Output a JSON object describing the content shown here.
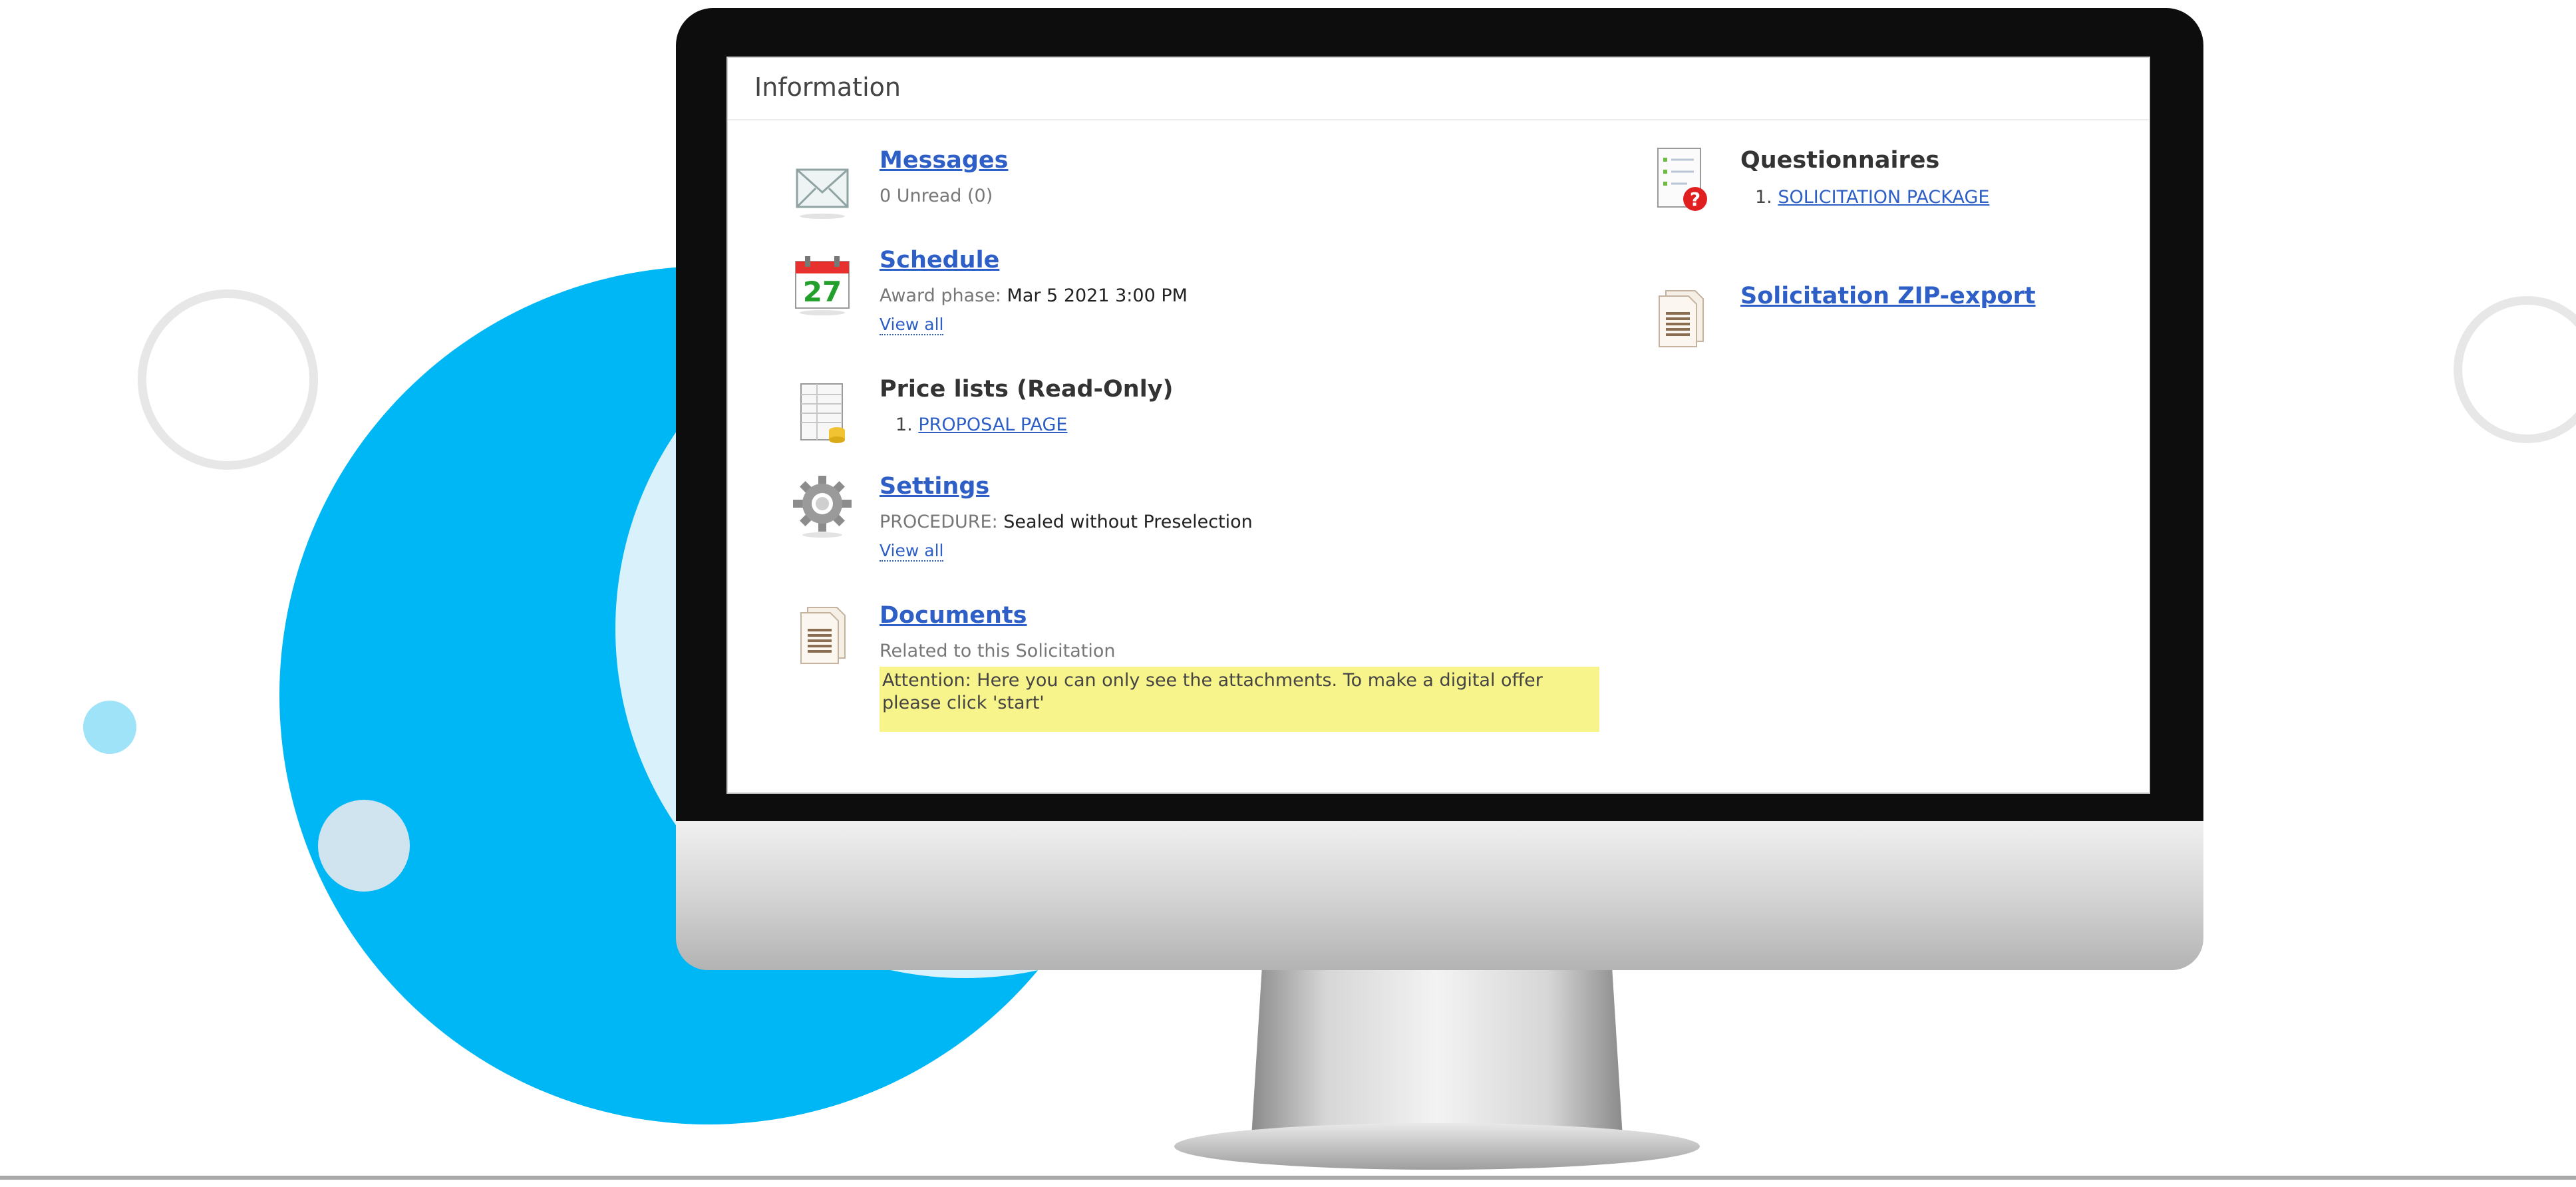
{
  "panel": {
    "title": "Information"
  },
  "messages": {
    "title": "Messages",
    "subtitle": "0 Unread (0)"
  },
  "schedule": {
    "day": "27",
    "title": "Schedule",
    "label": "Award phase:",
    "value": "Mar 5 2021 3:00 PM",
    "view_all": "View all"
  },
  "price_lists": {
    "title": "Price lists (Read-Only)",
    "item_number": "1.",
    "item_link": "PROPOSAL PAGE"
  },
  "settings": {
    "title": "Settings",
    "label": "PROCEDURE:",
    "value": "Sealed without Preselection",
    "view_all": "View all"
  },
  "documents": {
    "title": "Documents",
    "subtitle": "Related to this Solicitation",
    "attention": "Attention: Here you can only see the attachments. To make a digital offer please click 'start'"
  },
  "questionnaires": {
    "title": "Questionnaires",
    "item_number": "1.",
    "item_link": "SOLICITATION PACKAGE"
  },
  "zip_export": {
    "title": "Solicitation ZIP-export"
  },
  "colors": {
    "link": "#2e5fc7",
    "accent_blue": "#00b7f5",
    "attention_bg": "#f8f48c"
  },
  "icons": [
    "envelope-icon",
    "calendar-icon",
    "price-list-icon",
    "gear-icon",
    "document-icon",
    "questionnaire-icon",
    "zip-document-icon"
  ]
}
